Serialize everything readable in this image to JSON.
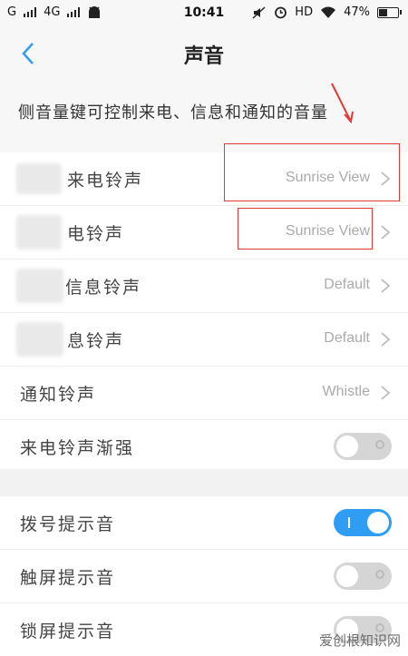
{
  "status_bar": {
    "left_text_1": "G",
    "left_text_2": "4G",
    "time": "10:41",
    "hd_label": "HD",
    "battery_percent": "47%",
    "battery_level": 0.47
  },
  "header": {
    "title": "声音",
    "back_icon": "chevron-left-icon"
  },
  "description": "侧音量键可控制来电、信息和通知的音量",
  "ringtones": [
    {
      "label": "来电铃声",
      "value": "Sunrise View"
    },
    {
      "label": "电铃声",
      "value": "Sunrise View"
    },
    {
      "label": "信息铃声",
      "value": "Default"
    },
    {
      "label": "息铃声",
      "value": "Default"
    },
    {
      "label": "通知铃声",
      "value": "Whistle"
    },
    {
      "label": "来电铃声渐强",
      "toggle": false
    }
  ],
  "feedback": [
    {
      "label": "拨号提示音",
      "toggle": true
    },
    {
      "label": "触屏提示音",
      "toggle": false
    },
    {
      "label": "锁屏提示音",
      "toggle": false
    }
  ],
  "watermark": "爱创根知识网",
  "colors": {
    "accent": "#2e9df3",
    "annotation_red": "#e53935",
    "toggle_off": "#d5d5d5"
  }
}
